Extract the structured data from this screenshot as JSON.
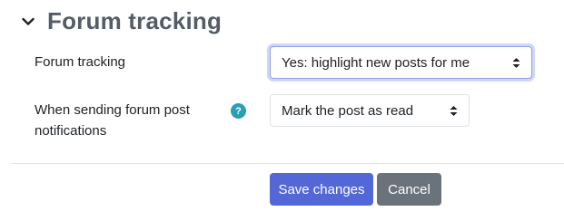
{
  "section": {
    "title": "Forum tracking"
  },
  "fields": {
    "forum_tracking": {
      "label": "Forum tracking",
      "selected": "Yes: highlight new posts for me"
    },
    "post_notifications": {
      "label_line1": "When sending forum post",
      "label_line2": "notifications",
      "help": "?",
      "selected": "Mark the post as read"
    }
  },
  "actions": {
    "save_label": "Save changes",
    "cancel_label": "Cancel"
  },
  "icons": {
    "collapse": "chevron-down-icon",
    "help": "question-circle-icon",
    "select": "sort-icon"
  },
  "colors": {
    "primary": "#5467d6",
    "secondary": "#6a737b",
    "help": "#2a9fb0",
    "title": "#545c66"
  }
}
